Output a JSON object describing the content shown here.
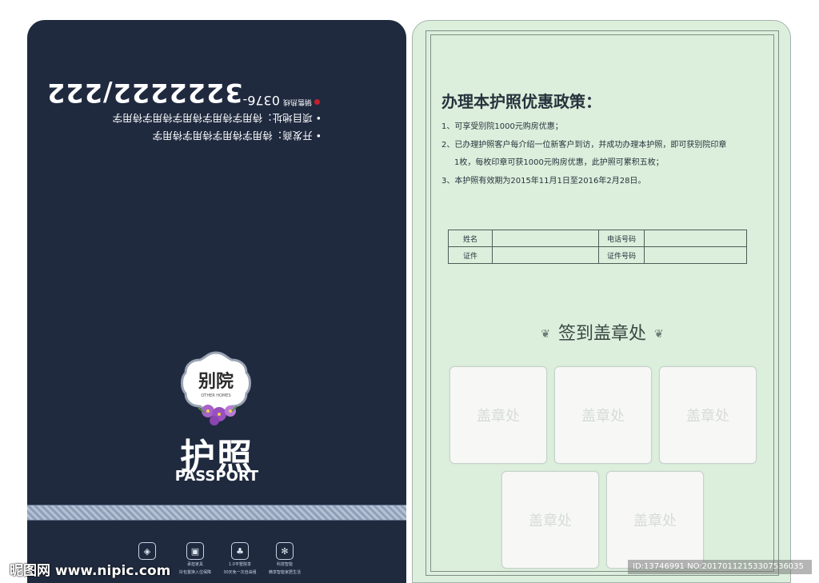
{
  "cover": {
    "flipped_line1": "• 开发商：待用字待用字待用字待用字",
    "flipped_line2": "• 项目地址：待用字待用字待用字待用字待用字",
    "hotline_label": "销售热线",
    "area_code": "0376-",
    "phone_number": "3222222/222",
    "logo_text": "别院",
    "logo_subtext": "OTHER HOMES",
    "title_cn": "护照",
    "title_en": "PASSPORT",
    "features": [
      {
        "icon": "diamond-icon",
        "line1": "",
        "line2": ""
      },
      {
        "icon": "sofa-icon",
        "line1": "承担家具",
        "line2": "拎包置换入住保障"
      },
      {
        "icon": "tree-icon",
        "line1": "1.0平墅院享",
        "line2": "30天免一次自由租"
      },
      {
        "icon": "network-icon",
        "line1": "科技智能",
        "line2": "精享智能家居生活"
      }
    ]
  },
  "policy": {
    "title": "办理本护照优惠政策：",
    "items": [
      "1、可享受别院1000元购房优惠；",
      "2、已办理护照客户每介绍一位新客户到访，并成功办理本护照，即可获别院印章",
      "1枚，每枚印章可获1000元购房优惠，此护照可累积五枚；",
      "3、本护照有效期为2015年11月1日至2016年2月28日。"
    ]
  },
  "form": {
    "name_label": "姓名",
    "phone_label": "电话号码",
    "id_label": "证件",
    "id_number_label": "证件号码"
  },
  "sign": {
    "title": "签到盖章处",
    "stamp_label": "盖章处"
  },
  "watermark": {
    "left": "昵图网 www.nipic.com",
    "right": "ID:13746991 NO:20170112153307536035"
  },
  "colors": {
    "cover_bg": "#1f2a3f",
    "page_bg": "#dcefdc",
    "accent_red": "#c3202b"
  }
}
